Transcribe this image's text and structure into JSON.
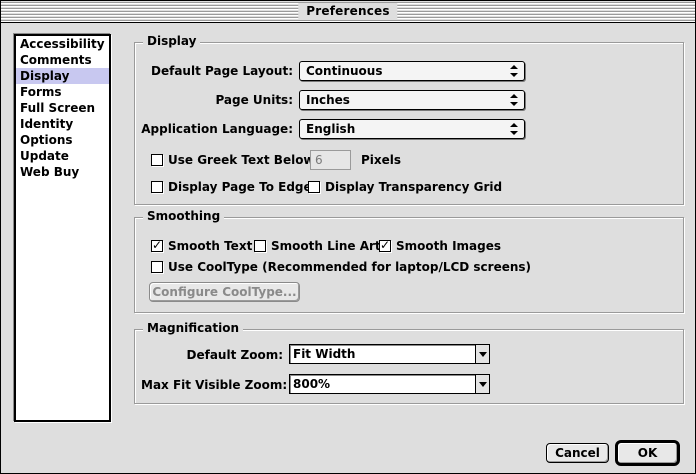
{
  "window": {
    "title": "Preferences"
  },
  "sidebar": {
    "items": [
      {
        "label": "Accessibility",
        "selected": false
      },
      {
        "label": "Comments",
        "selected": false
      },
      {
        "label": "Display",
        "selected": true
      },
      {
        "label": "Forms",
        "selected": false
      },
      {
        "label": "Full Screen",
        "selected": false
      },
      {
        "label": "Identity",
        "selected": false
      },
      {
        "label": "Options",
        "selected": false
      },
      {
        "label": "Update",
        "selected": false
      },
      {
        "label": "Web Buy",
        "selected": false
      }
    ]
  },
  "display": {
    "title": "Display",
    "page_layout_label": "Default Page Layout:",
    "page_layout_value": "Continuous",
    "page_units_label": "Page Units:",
    "page_units_value": "Inches",
    "language_label": "Application Language:",
    "language_value": "English",
    "greek_text_label": "Use Greek Text Below",
    "greek_text_checked": false,
    "greek_text_value": "6",
    "greek_text_unit": "Pixels",
    "page_to_edge_label": "Display Page To Edge",
    "page_to_edge_checked": false,
    "transparency_grid_label": "Display Transparency Grid",
    "transparency_grid_checked": false
  },
  "smoothing": {
    "title": "Smoothing",
    "smooth_text_label": "Smooth Text",
    "smooth_text_checked": true,
    "smooth_line_art_label": "Smooth Line Art",
    "smooth_line_art_checked": false,
    "smooth_images_label": "Smooth Images",
    "smooth_images_checked": true,
    "cooltype_label": "Use CoolType (Recommended for laptop/LCD screens)",
    "cooltype_checked": false,
    "configure_cooltype_label": "Configure CoolType..."
  },
  "magnification": {
    "title": "Magnification",
    "default_zoom_label": "Default Zoom:",
    "default_zoom_value": "Fit Width",
    "max_fit_zoom_label": "Max Fit Visible Zoom:",
    "max_fit_zoom_value": "800%"
  },
  "footer": {
    "cancel_label": "Cancel",
    "ok_label": "OK"
  }
}
